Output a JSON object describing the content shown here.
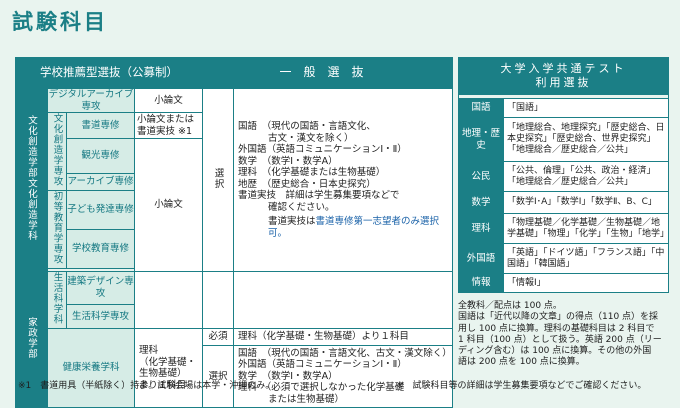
{
  "title": "試験科目",
  "main": {
    "header_left": "学校推薦型選抜（公募制）",
    "header_right": "一般選抜",
    "dept_bunka": "文化創造学部文化創造学科",
    "digital": "デジタルアーカイブ専攻",
    "bunka_sozo": "文化創造学専攻",
    "shodo": "書道専修",
    "kanko": "観光専修",
    "archive": "アーカイブ専修",
    "shoki": "初等教育学専攻",
    "kodomo": "子ども発達専修",
    "gakko": "学校教育専修",
    "shoronbun": "小論文",
    "shoronbun_or": "小論文または",
    "shodo_jitsugi": "書道実技 ※1",
    "shoronbun2": "小論文",
    "senbatsu": "選択",
    "ippan_lines": [
      "国語　（現代の国語・言語文化、",
      "古文・漢文を除く）",
      "外国語（英語コミュニケーションⅠ・Ⅱ）",
      "数学　（数学Ⅰ・数学A）",
      "理科　（化学基礎または生物基礎）",
      "地歴　（歴史総合・日本史探究）",
      "書道実技　詳細は学生募集要項などで",
      "確認ください。"
    ],
    "ippan_note_prefix": "書道実技は",
    "ippan_note_link": "書道専修第一志望者のみ選択可。",
    "dept_kasei": "家政学部",
    "seikatsu": "生活科学科",
    "kenchiku": "建築デザイン専攻",
    "seikatsu_senko": "生活科学専攻",
    "kenko": "健康栄養学科",
    "rika_lines": [
      "理科",
      "（化学基礎・",
      "生物基礎）",
      "より１科目"
    ],
    "hissu": "必須",
    "hissu_text": "理科（化学基礎・生物基礎）より１科目",
    "senbatsu2": "選択",
    "kasei_lines": [
      "国語　（現代の国語・言語文化、古文・漢文除く）",
      "外国語（英語コミュニケーションⅠ・Ⅱ）",
      "数学　（数学Ⅰ・数学A）",
      "理科　（必須で選択しなかった化学基礎",
      "または生物基礎）"
    ]
  },
  "right": {
    "header": [
      "大学入学共通テスト",
      "利用選抜"
    ],
    "rows": [
      {
        "label": "国語",
        "value": "「国語」"
      },
      {
        "label": "地理・歴史",
        "value": "「地理総合、地理探究」「歴史総合、日本史探究」「歴史総合、世界史探究」「地理総合／歴史総合／公共」"
      },
      {
        "label": "公民",
        "value": "「公共、倫理」「公共、政治・経済」「地理総合／歴史総合／公共」"
      },
      {
        "label": "数学",
        "value": "「数学Ⅰ･A」「数学Ⅰ」「数学Ⅱ、B、C」"
      },
      {
        "label": "理科",
        "value": "「物理基礎／化学基礎／生物基礎／地学基礎」「物理」「化学」「生物」「地学」"
      },
      {
        "label": "外国語",
        "value": "「英語」「ドイツ語」「フランス語」「中国語」「韓国語」"
      },
      {
        "label": "情報",
        "value": "「情報Ⅰ」"
      }
    ],
    "note_lines": [
      "全教科／配点は 100 点。",
      "国語は「近代以降の文章」の得点（110 点）を採",
      "用し 100 点に換算。理科の基礎科目は 2 科目で",
      "1 科目（100 点）として扱う。英語 200 点（リー",
      "ディング含む）は 100 点に換算。その他の外国",
      "語は 200 点を 100 点に換算。"
    ]
  },
  "footnote_left": "※1　書道用具（半紙除く）持参。試験会場は本学・沖縄のみ。",
  "footnote_right": "※　試験科目等の詳細は学生募集要項などでご確認ください。"
}
